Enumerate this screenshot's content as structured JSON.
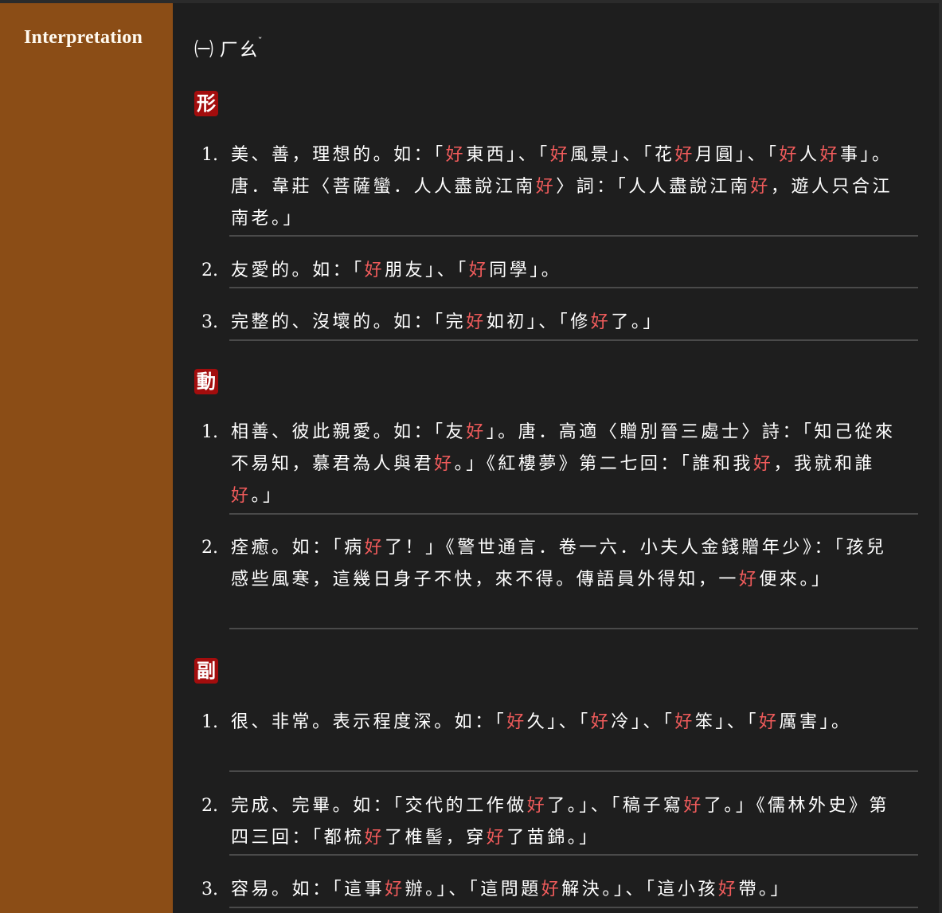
{
  "sidebar": {
    "title": "Interpretation"
  },
  "heading": {
    "prefix": "㈠ ",
    "text": "ㄏㄠ",
    "tone": "ˇ"
  },
  "sections": [
    {
      "pos": "形",
      "items": [
        {
          "num": "1.",
          "text": "美、善，理想的。如：「好東西」、「好風景」、「花好月圓」、「好人好事」。唐．韋莊〈菩薩蠻．人人盡說江南好〉詞：「人人盡說江南好，遊人只合江南老。」"
        },
        {
          "num": "2.",
          "text": "友愛的。如：「好朋友」、「好同學」。"
        },
        {
          "num": "3.",
          "text": "完整的、沒壞的。如：「完好如初」、「修好了。」"
        }
      ]
    },
    {
      "pos": "動",
      "items": [
        {
          "num": "1.",
          "text": "相善、彼此親愛。如：「友好」。唐．高適〈贈別晉三處士〉詩：「知己從來不易知，慕君為人與君好。」《紅樓夢》第二七回：「誰和我好，我就和誰好。」"
        },
        {
          "num": "2.",
          "text": "痊癒。如：「病好了！」《警世通言．卷一六．小夫人金錢贈年少》：「孩兒感些風寒，這幾日身子不快，來不得。傳語員外得知，一好便來。」"
        }
      ]
    },
    {
      "pos": "副",
      "items": [
        {
          "num": "1.",
          "text": "很、非常。表示程度深。如：「好久」、「好冷」、「好笨」、「好厲害」。"
        },
        {
          "num": "2.",
          "text": "完成、完畢。如：「交代的工作做好了。」、「稿子寫好了。」《儒林外史》第四三回：「都梳好了椎髻，穿好了苗錦。」"
        },
        {
          "num": "3.",
          "text": "容易。如：「這事好辦。」、「這問題好解決。」、「這小孩好帶。」"
        }
      ]
    }
  ],
  "colors": {
    "highlight": "#f05b5b",
    "example": "#7fa8cf",
    "badge": "#a30d0d",
    "sidebar": "#8b4d16"
  }
}
